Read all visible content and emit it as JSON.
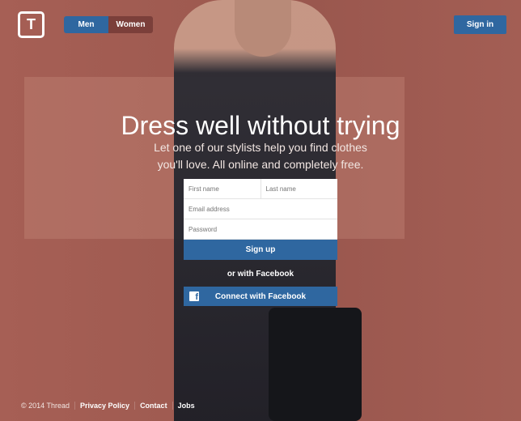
{
  "header": {
    "logo": "T",
    "gender_tabs": [
      {
        "label": "Men",
        "active": true
      },
      {
        "label": "Women",
        "active": false
      }
    ],
    "signin_label": "Sign in"
  },
  "hero": {
    "title": "Dress well without trying",
    "subtitle": "Let one of our stylists help you find clothes you'll love. All online and completely free."
  },
  "form": {
    "first_name_placeholder": "First name",
    "last_name_placeholder": "Last name",
    "email_placeholder": "Email address",
    "password_placeholder": "Password",
    "signup_label": "Sign up",
    "or_label": "or with Facebook",
    "facebook_label": "Connect with Facebook"
  },
  "footer": {
    "copyright": "© 2014 Thread",
    "links": [
      "Privacy Policy",
      "Contact",
      "Jobs"
    ]
  },
  "colors": {
    "accent": "#2f67a0",
    "background": "#a25c52"
  }
}
